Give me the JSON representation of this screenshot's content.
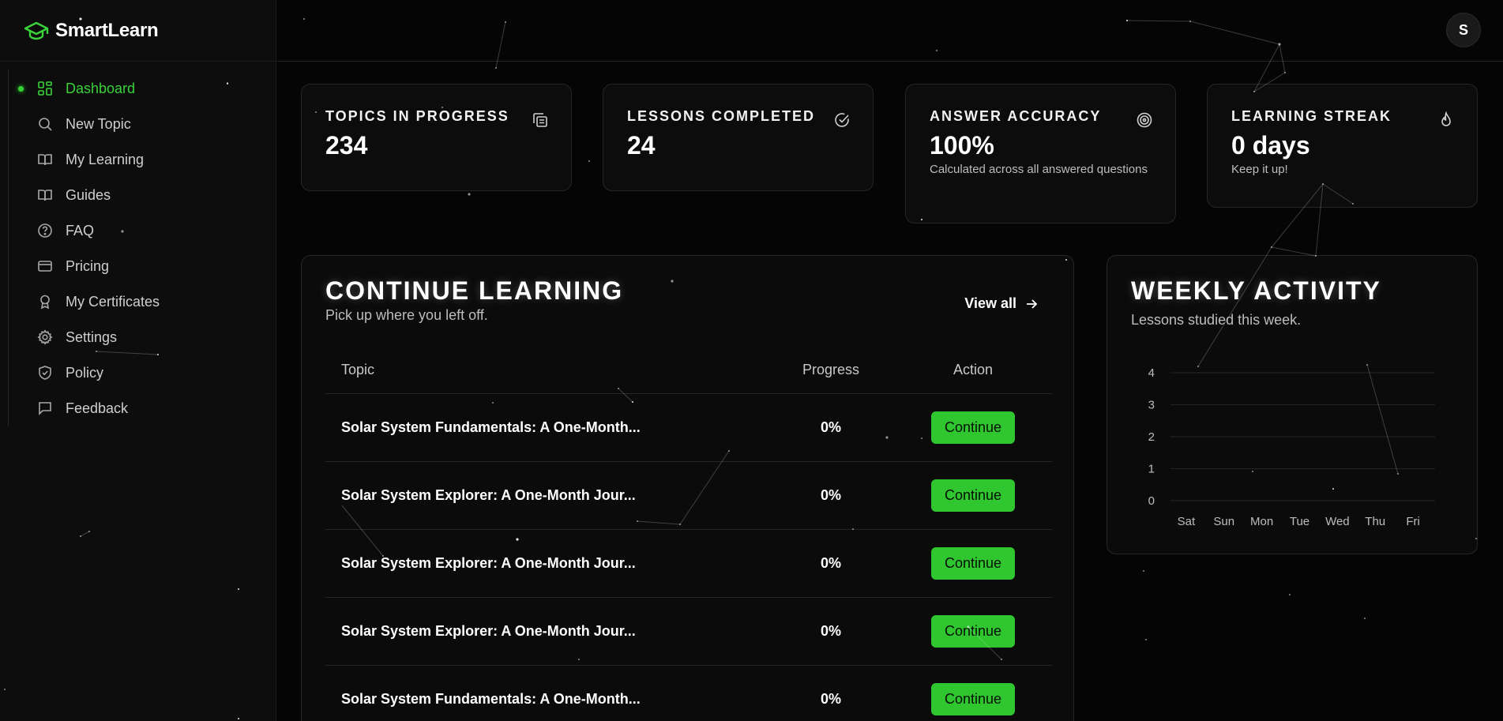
{
  "app": {
    "name": "SmartLearn"
  },
  "sidebar": {
    "items": [
      {
        "label": "Dashboard",
        "icon": "dashboard-icon",
        "active": true
      },
      {
        "label": "New Topic",
        "icon": "search-icon"
      },
      {
        "label": "My Learning",
        "icon": "book-open-icon"
      },
      {
        "label": "Guides",
        "icon": "book-open-icon"
      },
      {
        "label": "FAQ",
        "icon": "help-circle-icon"
      },
      {
        "label": "Pricing",
        "icon": "credit-card-icon"
      },
      {
        "label": "My Certificates",
        "icon": "award-icon"
      },
      {
        "label": "Settings",
        "icon": "gear-icon"
      },
      {
        "label": "Policy",
        "icon": "shield-check-icon"
      },
      {
        "label": "Feedback",
        "icon": "message-square-icon"
      }
    ]
  },
  "header": {
    "avatar_initial": "S"
  },
  "stats": [
    {
      "title": "TOPICS IN PROGRESS",
      "value": "234",
      "sub": "",
      "icon": "copy-icon"
    },
    {
      "title": "LESSONS COMPLETED",
      "value": "24",
      "sub": "",
      "icon": "check-circle-icon"
    },
    {
      "title": "ANSWER ACCURACY",
      "value": "100%",
      "sub": "Calculated across all answered questions",
      "icon": "target-icon"
    },
    {
      "title": "LEARNING STREAK",
      "value": "0 days",
      "sub": "Keep it up!",
      "icon": "flame-icon"
    }
  ],
  "continue_learning": {
    "title": "CONTINUE LEARNING",
    "subtitle": "Pick up where you left off.",
    "view_all": "View all",
    "columns": [
      "Topic",
      "Progress",
      "Action"
    ],
    "rows": [
      {
        "topic": "Solar System Fundamentals: A One-Month...",
        "progress": "0%",
        "action": "Continue"
      },
      {
        "topic": "Solar System Explorer: A One-Month Jour...",
        "progress": "0%",
        "action": "Continue"
      },
      {
        "topic": "Solar System Explorer: A One-Month Jour...",
        "progress": "0%",
        "action": "Continue"
      },
      {
        "topic": "Solar System Explorer: A One-Month Jour...",
        "progress": "0%",
        "action": "Continue"
      },
      {
        "topic": "Solar System Fundamentals: A One-Month...",
        "progress": "0%",
        "action": "Continue"
      }
    ]
  },
  "weekly_activity": {
    "title": "WEEKLY ACTIVITY",
    "subtitle": "Lessons studied this week."
  },
  "chart_data": {
    "type": "bar",
    "categories": [
      "Sat",
      "Sun",
      "Mon",
      "Tue",
      "Wed",
      "Thu",
      "Fri"
    ],
    "values": [
      0,
      0,
      0,
      0,
      0,
      0,
      0
    ],
    "ylim": [
      0,
      4
    ],
    "yticks": [
      "0",
      "1",
      "2",
      "3",
      "4"
    ],
    "grid": true,
    "title": "",
    "xlabel": "",
    "ylabel": ""
  },
  "colors": {
    "accent": "#2fc62f",
    "background": "#050505",
    "card": "#0c0c0c"
  }
}
